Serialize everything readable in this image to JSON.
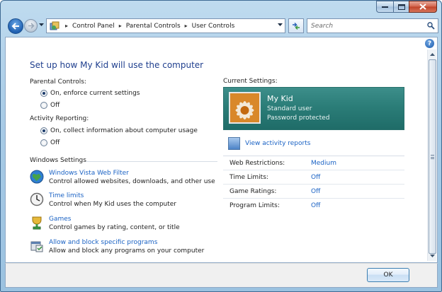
{
  "window": {
    "controls": {
      "minimize": "minimize-icon",
      "maximize": "maximize-icon",
      "close": "close-icon"
    }
  },
  "navigation": {
    "back_icon": "back-arrow-icon",
    "forward_icon": "forward-arrow-icon",
    "breadcrumb": [
      "Control Panel",
      "Parental Controls",
      "User Controls"
    ],
    "search_placeholder": "Search"
  },
  "main": {
    "title": "Set up how My Kid will use the computer",
    "parental_controls": {
      "label": "Parental Controls:",
      "options": [
        {
          "label": "On, enforce current settings",
          "selected": true
        },
        {
          "label": "Off",
          "selected": false
        }
      ]
    },
    "activity_reporting": {
      "label": "Activity Reporting:",
      "options": [
        {
          "label": "On, collect information about computer usage",
          "selected": true
        },
        {
          "label": "Off",
          "selected": false
        }
      ]
    },
    "windows_settings": {
      "label": "Windows Settings",
      "items": [
        {
          "link": "Windows Vista Web Filter",
          "description": "Control allowed websites, downloads, and other use",
          "icon": "globe-icon"
        },
        {
          "link": "Time limits",
          "description": "Control when My Kid uses the computer",
          "icon": "clock-icon"
        },
        {
          "link": "Games",
          "description": "Control games by rating, content, or title",
          "icon": "games-icon"
        },
        {
          "link": "Allow and block specific programs",
          "description": "Allow and block any programs on your computer",
          "icon": "programs-icon"
        }
      ]
    }
  },
  "current_settings": {
    "label": "Current Settings:",
    "user": {
      "name": "My Kid",
      "account_type": "Standard user",
      "password_status": "Password protected",
      "avatar_icon": "flower-avatar-icon"
    },
    "activity_link": "View activity reports",
    "limits": [
      {
        "name": "Web Restrictions:",
        "value": "Medium"
      },
      {
        "name": "Time Limits:",
        "value": "Off"
      },
      {
        "name": "Game Ratings:",
        "value": "Off"
      },
      {
        "name": "Program Limits:",
        "value": "Off"
      }
    ]
  },
  "footer": {
    "ok_label": "OK"
  },
  "colors": {
    "link": "#1a62c4",
    "title": "#1f3f8e",
    "user_panel": "#2b7d78",
    "frame": "#a8cbe6"
  }
}
